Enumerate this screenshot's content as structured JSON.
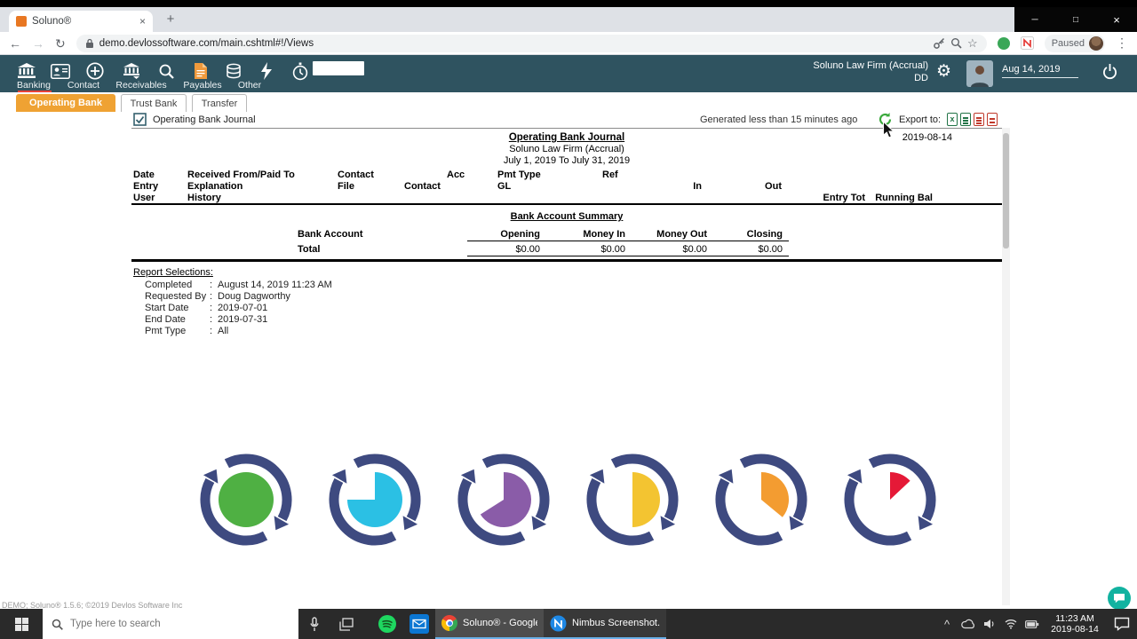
{
  "glyphs": {
    "back": "←",
    "forward": "→",
    "reload": "↻",
    "new_tab": "+",
    "tab_close": "×",
    "minimize": "─",
    "maximize": "□",
    "close": "×",
    "star": "☆",
    "menu": "⋮",
    "gear": "⚙",
    "tray_caret": "^",
    "excel_x": "x"
  },
  "browser": {
    "tab_title": "Soluno®",
    "url": "demo.devlossoftware.com/main.cshtml#!/Views",
    "paused_label": "Paused"
  },
  "app": {
    "nav": [
      {
        "label": "Banking"
      },
      {
        "label": "Contact"
      },
      {
        "label": "Receivables"
      },
      {
        "label": "Payables"
      },
      {
        "label": "Other"
      }
    ],
    "firm_name": "Soluno Law Firm (Accrual)",
    "user_initials": "DD",
    "date_field": "Aug 14, 2019",
    "subtabs": [
      {
        "label": "Operating Bank"
      },
      {
        "label": "Trust Bank"
      },
      {
        "label": "Transfer"
      }
    ]
  },
  "report_bar": {
    "title": "Operating Bank Journal",
    "generated": "Generated less than 15 minutes ago",
    "export_label": "Export to:",
    "export_icons": [
      "excel",
      "csv",
      "pdf",
      "pdf-alt"
    ]
  },
  "report": {
    "generated_date": "2019-08-14",
    "title": "Operating Bank Journal",
    "firm": "Soluno Law Firm (Accrual)",
    "period": "July 1, 2019 To July 31, 2019",
    "columns": {
      "date": "Date",
      "entry": "Entry",
      "user": "User",
      "received": "Received From/Paid To",
      "explanation": "Explanation",
      "history": "History",
      "contact": "Contact",
      "file": "File",
      "contact2": "Contact",
      "acc": "Acc",
      "pmt_type": "Pmt Type",
      "gl": "GL",
      "ref": "Ref",
      "in": "In",
      "out": "Out",
      "entry_tot": "Entry Tot",
      "running_bal": "Running Bal"
    },
    "summary": {
      "title": "Bank Account Summary",
      "row_header": "Bank Account",
      "col_headers": [
        "Opening",
        "Money In",
        "Money Out",
        "Closing"
      ],
      "total_label": "Total",
      "total_values": [
        "$0.00",
        "$0.00",
        "$0.00",
        "$0.00"
      ]
    },
    "selections": {
      "title": "Report Selections:",
      "colon": ":",
      "rows": [
        {
          "label": "Completed",
          "value": "August 14, 2019 11:23 AM"
        },
        {
          "label": "Requested By",
          "value": "Doug Dagworthy"
        },
        {
          "label": "Start Date",
          "value": "2019-07-01"
        },
        {
          "label": "End Date",
          "value": "2019-07-31"
        },
        {
          "label": "Pmt Type",
          "value": "All"
        }
      ]
    },
    "footer": "DEMO; Soluno® 1.5.6; ©2019 Devlos Software Inc"
  },
  "banner": {
    "ring_color": "#3e4a80",
    "logos": [
      {
        "name": "logo-pie-full",
        "color": "#4fb043",
        "fraction": 1
      },
      {
        "name": "logo-pie-three-quarter",
        "color": "#2bc0e4",
        "fraction": 0.75
      },
      {
        "name": "logo-pie-two-third",
        "color": "#8a5ca8",
        "fraction": 0.66
      },
      {
        "name": "logo-pie-half",
        "color": "#f3c431",
        "fraction": 0.5
      },
      {
        "name": "logo-pie-third",
        "color": "#f39c31",
        "fraction": 0.36
      },
      {
        "name": "logo-pie-eighth",
        "color": "#e51937",
        "fraction": 0.13
      }
    ]
  },
  "taskbar": {
    "search_placeholder": "Type here to search",
    "apps": [
      {
        "label": "Soluno® - Google..."
      },
      {
        "label": "Nimbus Screenshot..."
      }
    ],
    "time": "11:23 AM",
    "date": "2019-08-14"
  }
}
